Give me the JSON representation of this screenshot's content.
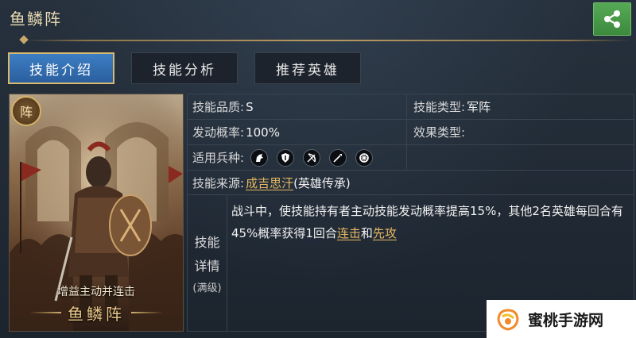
{
  "header": {
    "title": "鱼鳞阵",
    "share_icon": "share-icon"
  },
  "tabs": [
    {
      "label": "技能介绍",
      "active": true
    },
    {
      "label": "技能分析",
      "active": false
    },
    {
      "label": "推荐英雄",
      "active": false
    }
  ],
  "card": {
    "badge": "阵",
    "subtitle": "增益主动并连击",
    "name": "鱼鳞阵"
  },
  "info": {
    "quality_label": "技能品质:",
    "quality_value": "S",
    "type_label": "技能类型:",
    "type_value": "军阵",
    "rate_label": "发动概率:",
    "rate_value": "100%",
    "effect_label": "效果类型:",
    "effect_value": "",
    "troops_label": "适用兵种:",
    "troop_icons": [
      "cavalry-icon",
      "shield-infantry-icon",
      "archer-bow-icon",
      "spear-icon",
      "siege-wheel-icon"
    ],
    "source_label": "技能来源:",
    "source_link": "成吉思汗",
    "source_suffix": "(英雄传承)"
  },
  "detail": {
    "label_1": "技能",
    "label_2": "详情",
    "label_3": "(满级)",
    "text_1": "战斗中，使技能持有者主动技能发动概率提高15%，其他2名英雄每回合有45%概率获得1回合",
    "link_1": "连击",
    "text_2": "和",
    "link_2": "先攻"
  },
  "watermark": {
    "text": "蜜桃手游网"
  },
  "colors": {
    "accent_gold": "#d9b870",
    "tab_blue": "#3d7ec4",
    "share_green": "#4a9a4a",
    "link": "#e7b860"
  }
}
